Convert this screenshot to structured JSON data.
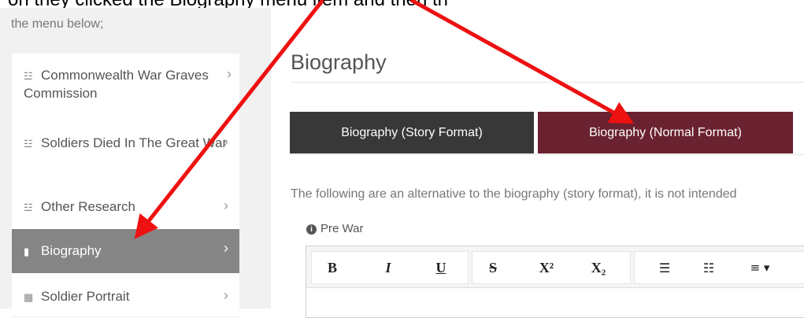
{
  "top_text": "on they clicked the Biography menu item and then the",
  "sidebar": {
    "intro": "the menu below;",
    "items": [
      {
        "icon": "database-icon",
        "label": "Commonwealth War Graves Commission"
      },
      {
        "icon": "database-icon",
        "label": "Soldiers Died In The Great War"
      },
      {
        "icon": "database-icon",
        "label": "Other Research"
      },
      {
        "icon": "book-icon",
        "label": "Biography"
      },
      {
        "icon": "image-icon",
        "label": "Soldier Portrait"
      }
    ],
    "chevron": "›"
  },
  "main": {
    "title": "Biography",
    "tabs": [
      {
        "label": "Biography (Story Format)"
      },
      {
        "label": "Biography (Normal Format)"
      }
    ],
    "description": "The following are an alternative to the biography (story format), it is not intended",
    "section_label": "Pre War"
  },
  "toolbar": {
    "buttons": [
      {
        "name": "bold",
        "glyph": "B"
      },
      {
        "name": "italic",
        "glyph": "I"
      },
      {
        "name": "underline",
        "glyph": "U"
      },
      {
        "name": "strikethrough",
        "glyph": "S"
      },
      {
        "name": "superscript",
        "glyph": "X²"
      },
      {
        "name": "subscript",
        "glyph": "X₂"
      },
      {
        "name": "bullet-list",
        "glyph": "☰"
      },
      {
        "name": "numbered-list",
        "glyph": "☷"
      },
      {
        "name": "align",
        "glyph": "≡ ▾"
      }
    ]
  },
  "colors": {
    "active_tab": "#6b2230",
    "inactive_tab": "#383838",
    "active_menu": "#858585",
    "annotation_arrow": "#ee1111"
  }
}
